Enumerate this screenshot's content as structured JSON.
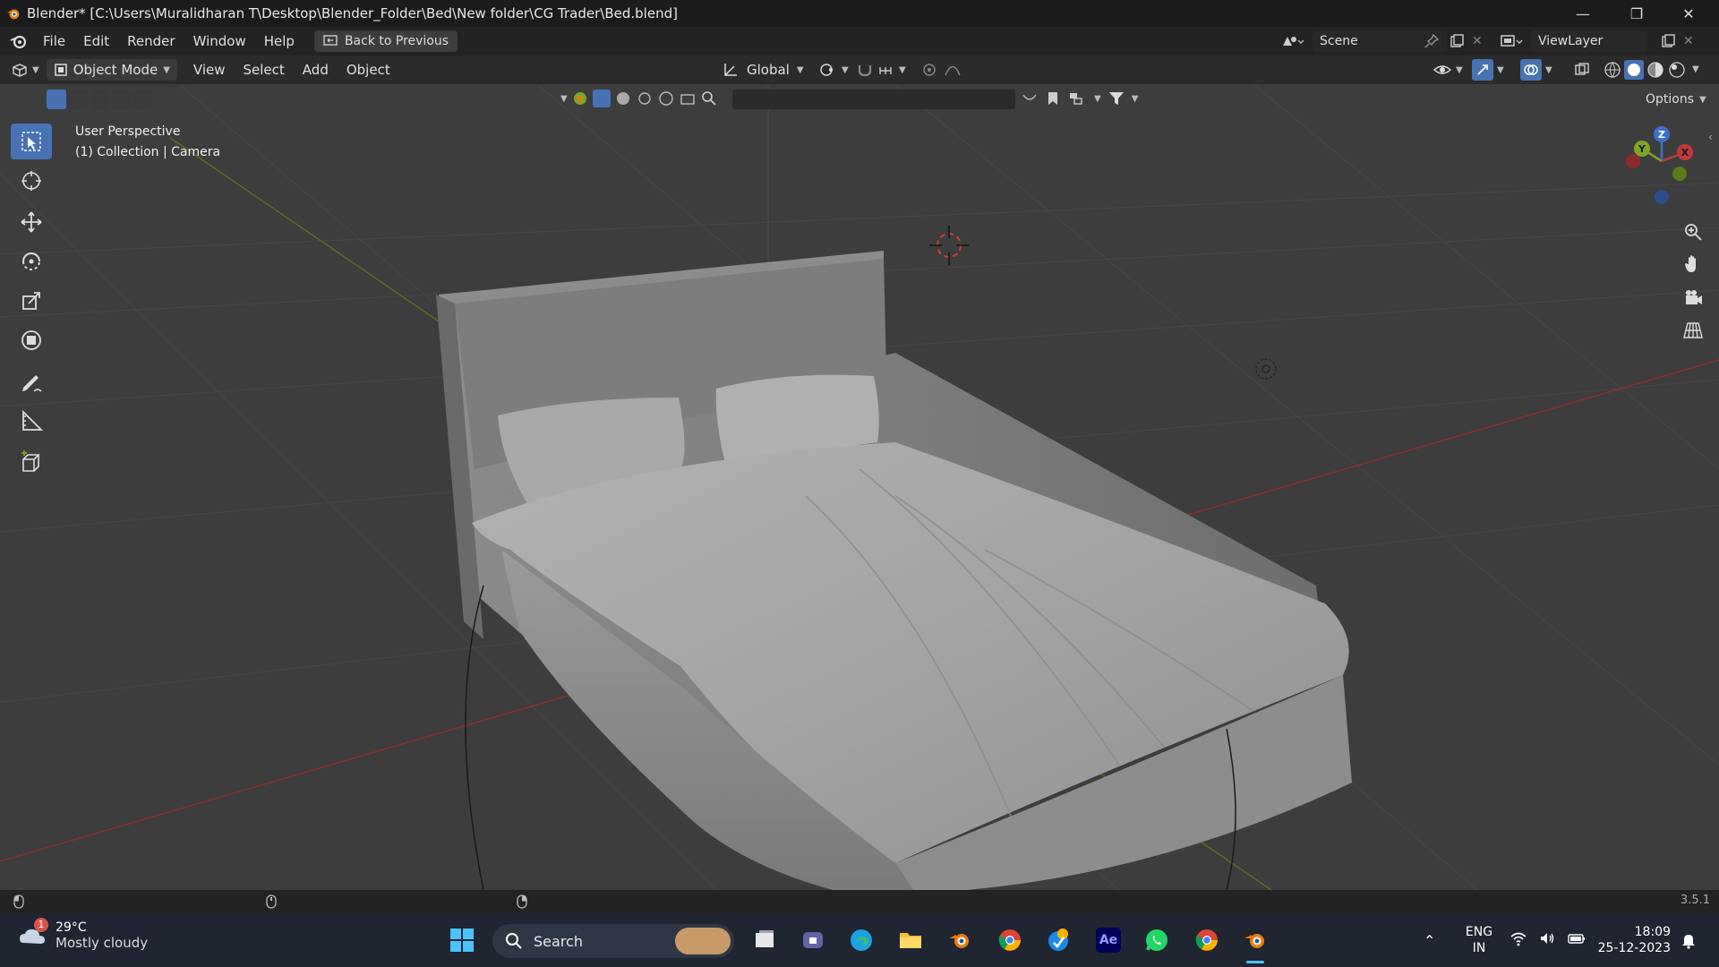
{
  "window": {
    "title": "Blender* [C:\\Users\\Muralidharan T\\Desktop\\Blender_Folder\\Bed\\New folder\\CG Trader\\Bed.blend]"
  },
  "menubar": {
    "items": [
      "File",
      "Edit",
      "Render",
      "Window",
      "Help"
    ],
    "back_button": "Back to Previous",
    "scene_label": "Scene",
    "viewlayer_label": "ViewLayer"
  },
  "viewport_header": {
    "mode": "Object Mode",
    "menus": [
      "View",
      "Select",
      "Add",
      "Object"
    ],
    "orientation": "Global",
    "options": "Options"
  },
  "viewport": {
    "perspective": "User Perspective",
    "collection": "(1) Collection | Camera"
  },
  "gizmo": {
    "z": "Z",
    "y": "Y",
    "x": "X"
  },
  "statusbar": {
    "version": "3.5.1"
  },
  "taskbar": {
    "weather_badge": "1",
    "temperature": "29°C",
    "condition": "Mostly cloudy",
    "search": "Search",
    "language": "ENG",
    "region": "IN",
    "time": "18:09",
    "date": "25-12-2023",
    "apps": [
      "windows-start",
      "task-view",
      "teams",
      "edge",
      "file-explorer",
      "blender",
      "chrome",
      "tracker",
      "after-effects",
      "whatsapp",
      "chrome-profile",
      "blender-active"
    ]
  },
  "colors": {
    "accent": "#4772b3",
    "viewport_bg": "#3d3d3d",
    "axis_x": "#c0393b",
    "axis_y": "#7ea524"
  }
}
